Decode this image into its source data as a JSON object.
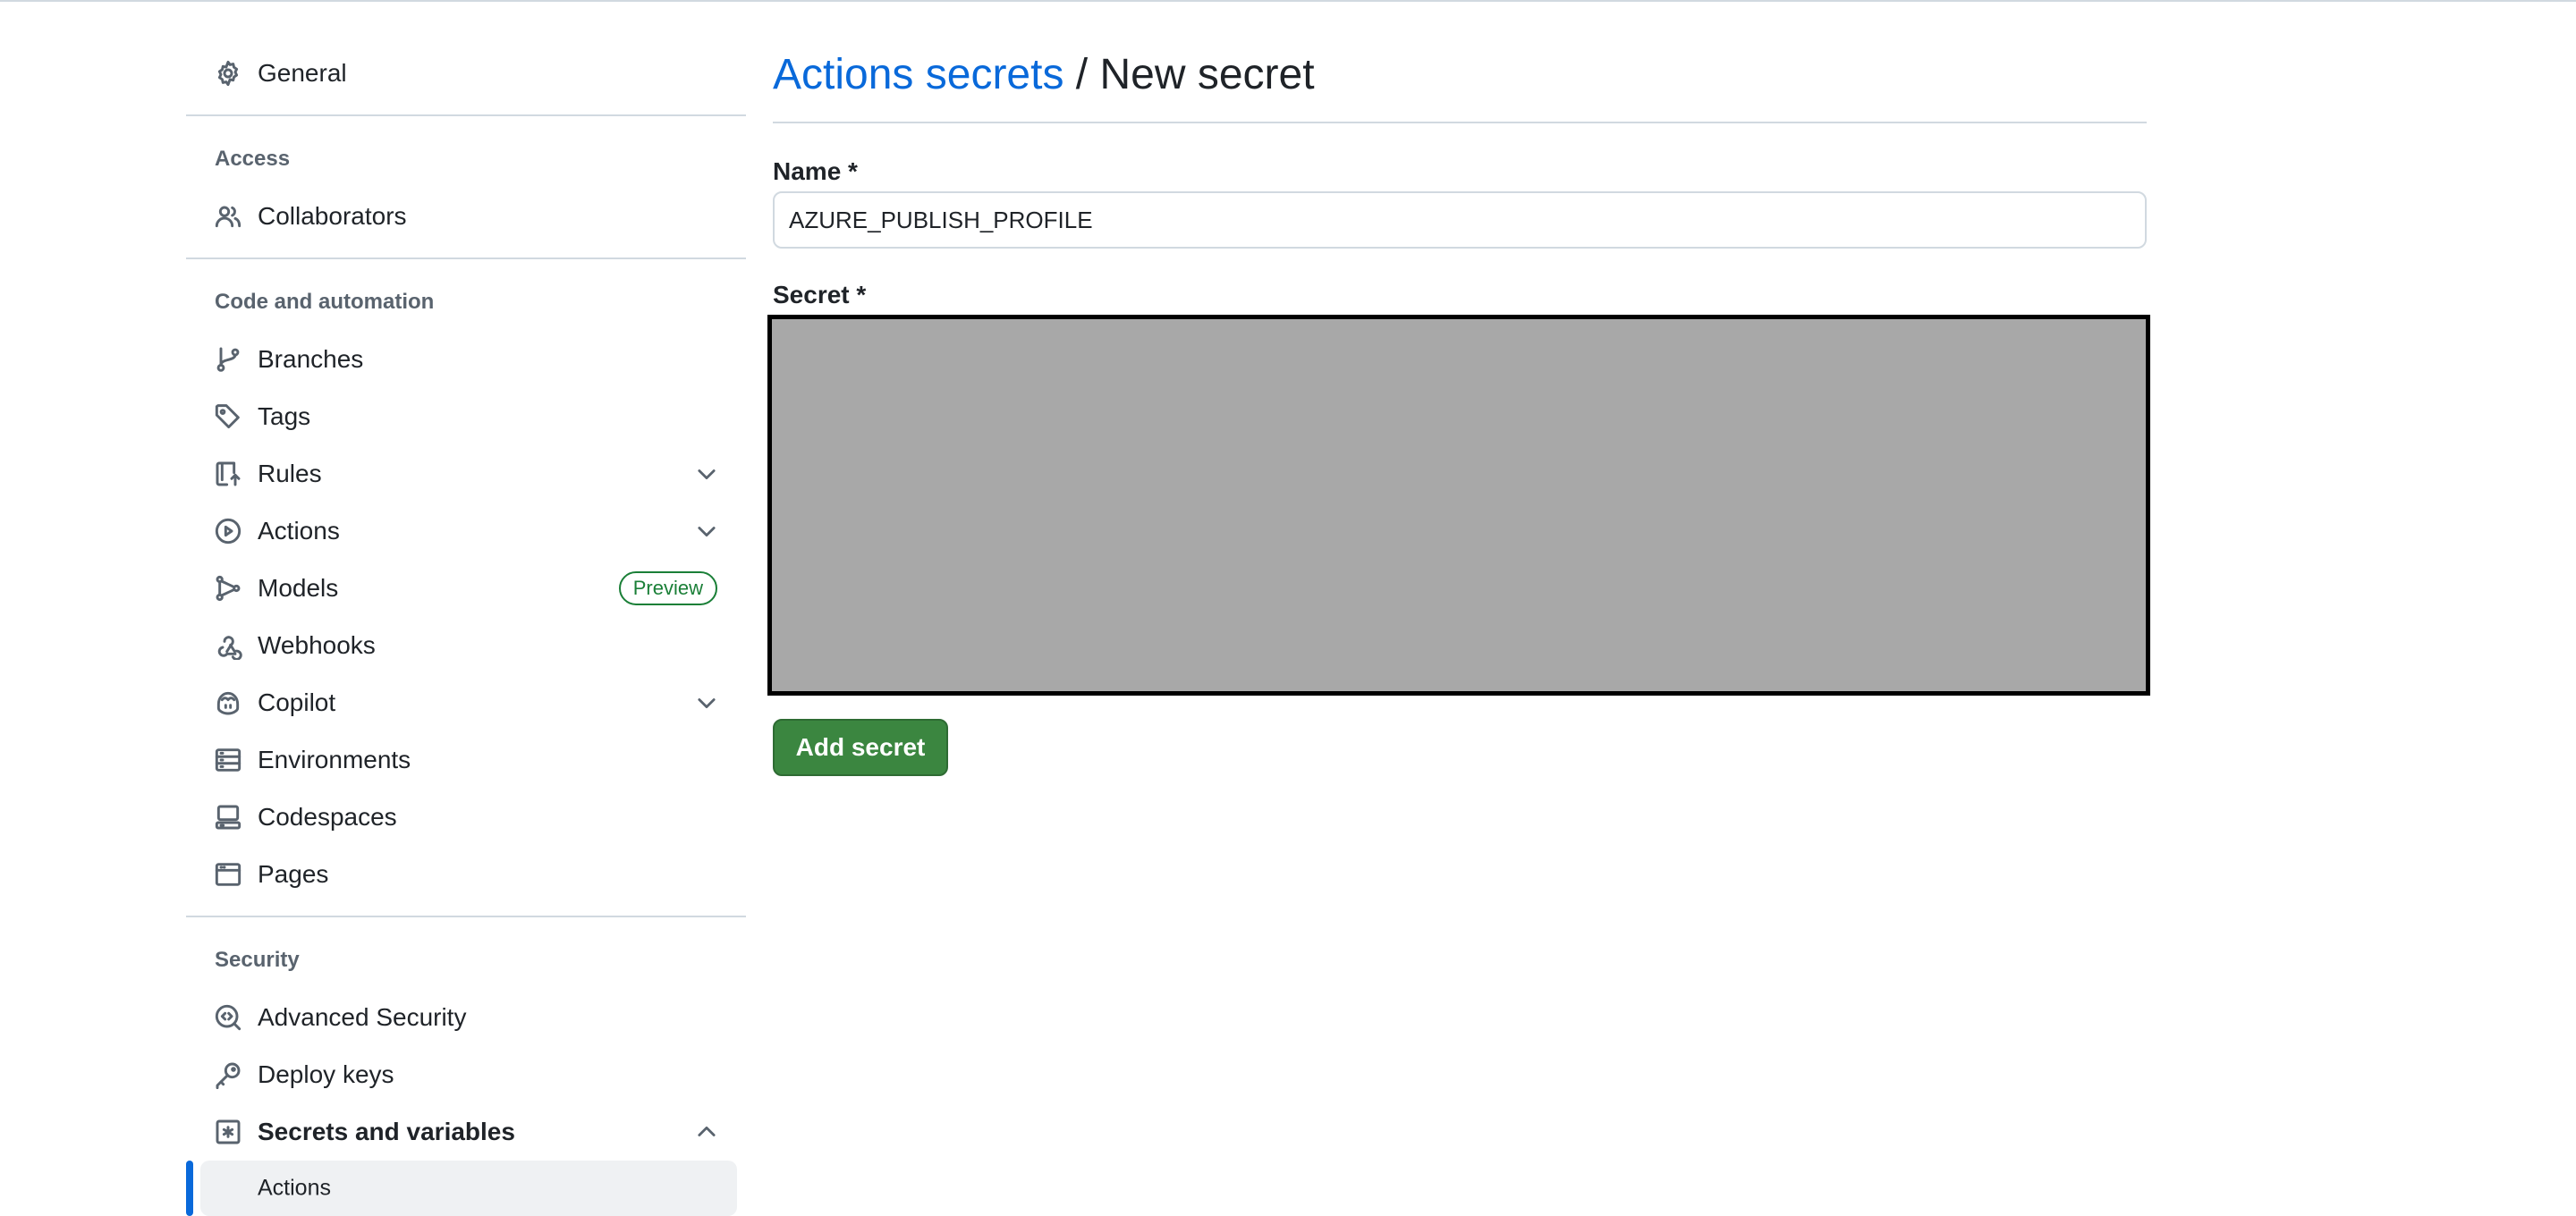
{
  "sidebar": {
    "general": {
      "label": "General",
      "icon": "gear-icon"
    },
    "access": {
      "title": "Access",
      "collaborators": {
        "label": "Collaborators",
        "icon": "people-icon"
      }
    },
    "code_automation": {
      "title": "Code and automation",
      "branches": {
        "label": "Branches",
        "icon": "git-branch-icon"
      },
      "tags": {
        "label": "Tags",
        "icon": "tag-icon"
      },
      "rules": {
        "label": "Rules",
        "icon": "repo-push-icon"
      },
      "actions": {
        "label": "Actions",
        "icon": "play-icon"
      },
      "models": {
        "label": "Models",
        "icon": "models-icon",
        "badge": "Preview"
      },
      "webhooks": {
        "label": "Webhooks",
        "icon": "webhook-icon"
      },
      "copilot": {
        "label": "Copilot",
        "icon": "copilot-icon"
      },
      "environments": {
        "label": "Environments",
        "icon": "server-icon"
      },
      "codespaces": {
        "label": "Codespaces",
        "icon": "codespaces-icon"
      },
      "pages": {
        "label": "Pages",
        "icon": "browser-icon"
      }
    },
    "security": {
      "title": "Security",
      "advanced_security": {
        "label": "Advanced Security",
        "icon": "codescan-icon"
      },
      "deploy_keys": {
        "label": "Deploy keys",
        "icon": "key-icon"
      },
      "secrets_variables": {
        "label": "Secrets and variables",
        "icon": "asterisk-icon"
      },
      "secrets_actions": {
        "label": "Actions"
      }
    }
  },
  "main": {
    "breadcrumb_link": "Actions secrets",
    "breadcrumb_separator": " / ",
    "breadcrumb_current": "New secret",
    "name_label": "Name *",
    "name_value": "AZURE_PUBLISH_PROFILE",
    "secret_label": "Secret *",
    "add_button": "Add secret"
  },
  "colors": {
    "link": "#0969da",
    "primary_button": "#3b8640",
    "badge_green": "#1a7f37",
    "redacted_fill": "#a8a8a8"
  }
}
